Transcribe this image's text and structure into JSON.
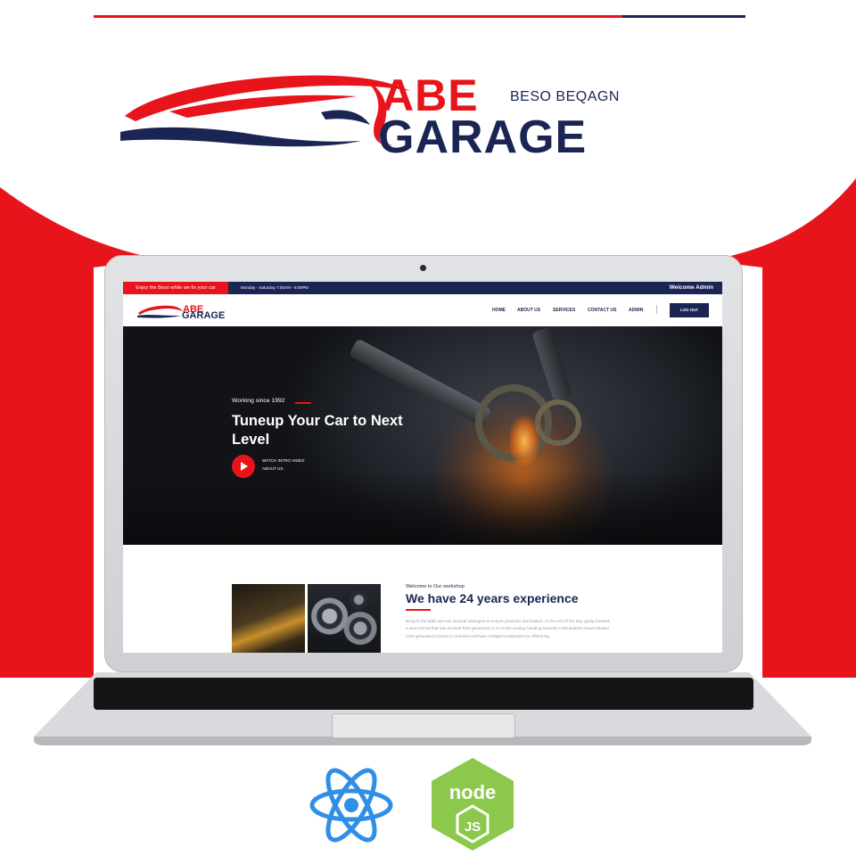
{
  "brand": {
    "abe": "ABE",
    "sub": "BESO BEQAGN",
    "garage": "GARAGE"
  },
  "colors": {
    "red": "#e8141b",
    "navy": "#1a2553",
    "node_green": "#8cc84b",
    "react_blue": "#2f8fe6"
  },
  "site": {
    "topbar": {
      "tagline": "Enjoy the Beso while we fix your car",
      "hours": "Monday - Saturday 7:00AM - 6:00PM",
      "welcome": "Welcome Admin"
    },
    "logo": {
      "abe": "ABE",
      "garage": "GARAGE"
    },
    "nav": {
      "items": [
        "HOME",
        "ABOUT US",
        "SERVICES",
        "CONTACT US",
        "ADMIN"
      ],
      "logout": "LOG OUT"
    },
    "hero": {
      "since": "Working since 1992",
      "title": "Tuneup Your Car to Next Level",
      "watch": "WATCH INTRO VIDEO",
      "about": "ABOUT US"
    },
    "welcome": {
      "subtitle": "Welcome to Our workshop",
      "title": "We have 24 years experience",
      "body": "Bring to the table win-win survival strategies to ensure proactive domination. At the end of the day, going forward, a new normal that has evolved from generation X is on the runway heading towards a streamlined cloud solution. User generated content in real-time will have multiple touchpoints for offshoring."
    }
  },
  "icons": {
    "react": "react-logo-icon",
    "node": "nodejs-logo-icon",
    "play": "play-icon",
    "car": "car-swoosh-icon"
  }
}
